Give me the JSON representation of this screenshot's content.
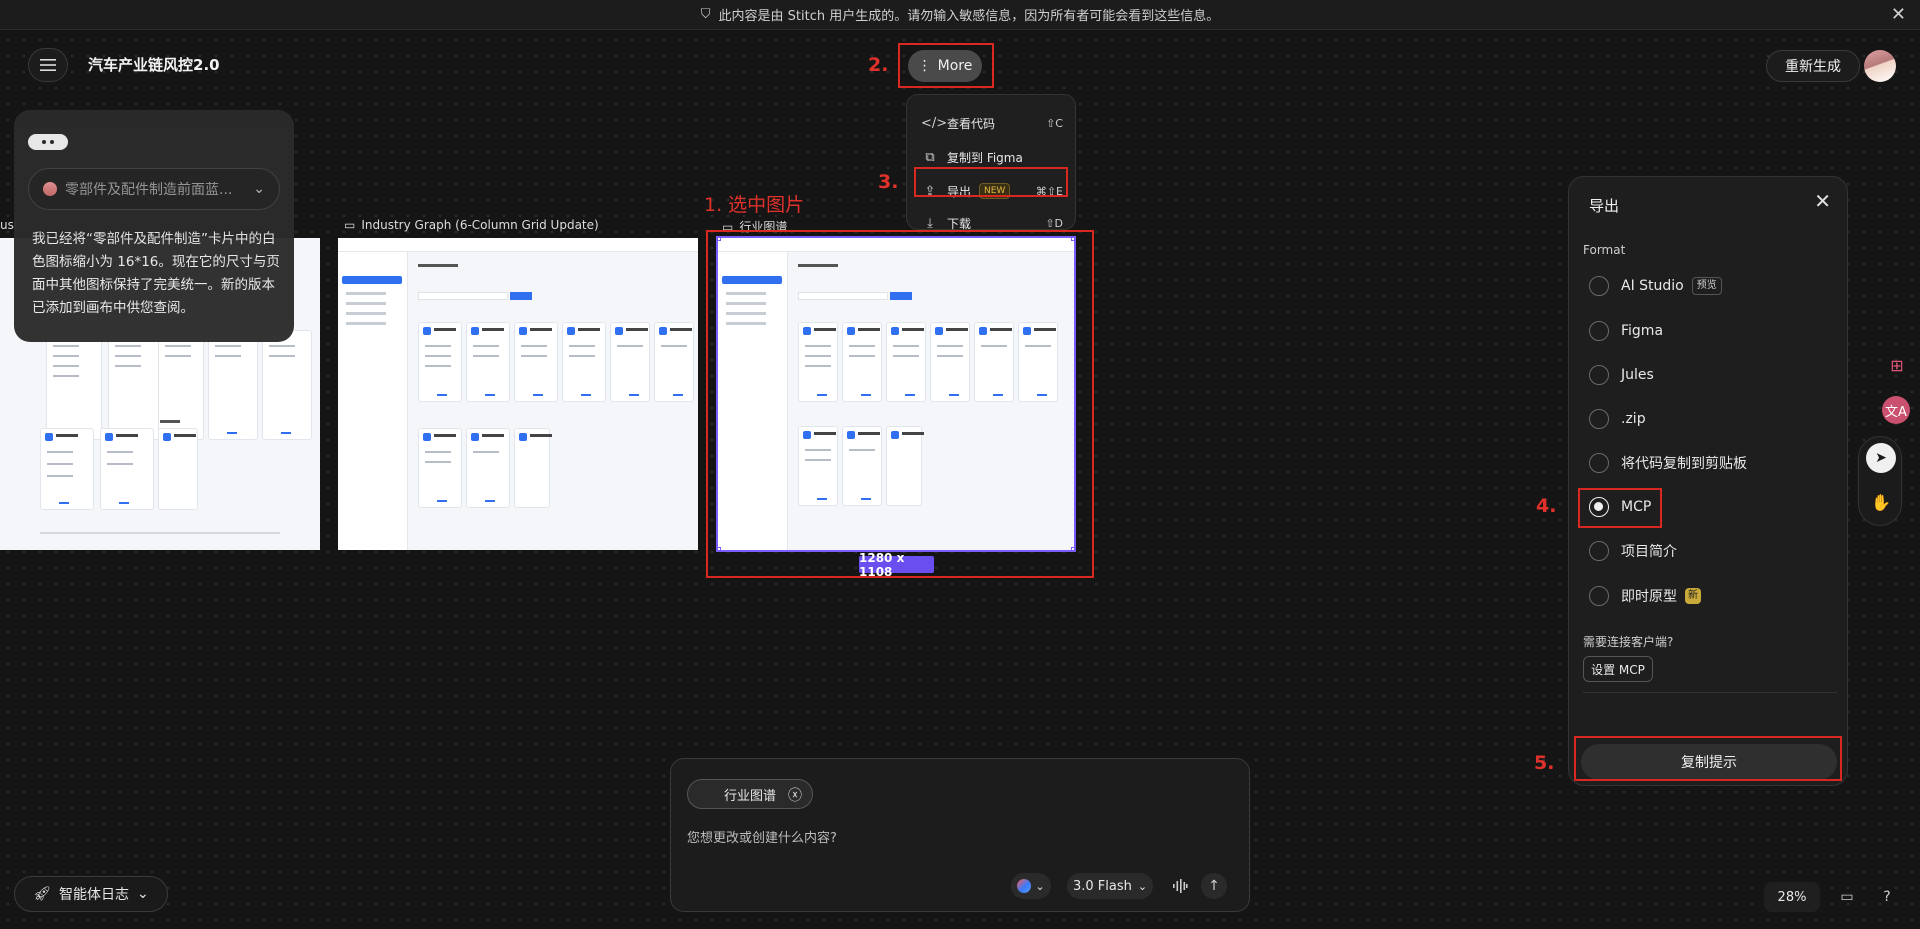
{
  "notice": {
    "text": "此内容是由 Stitch 用户生成的。请勿输入敏感信息，因为所有者可能会看到这些信息。"
  },
  "header": {
    "project_title": "汽车产业链风控2.0",
    "more_label": "More",
    "regenerate_label": "重新生成"
  },
  "annotations": {
    "a1": "1. 选中图片",
    "a2": "2.",
    "a3": "3.",
    "a4": "4.",
    "a5": "5."
  },
  "more_menu": {
    "items": [
      {
        "label": "查看代码",
        "shortcut": "⇧C",
        "icon": "code-icon"
      },
      {
        "label": "复制到 Figma",
        "shortcut": "",
        "icon": "copy-icon"
      },
      {
        "label": "导出",
        "badge": "NEW",
        "shortcut": "⌘⇧E",
        "icon": "export-icon"
      },
      {
        "label": "下载",
        "shortcut": "⇧D",
        "icon": "download-icon"
      }
    ]
  },
  "chat": {
    "selector_text": "零部件及配件制造前面蓝...",
    "message": "我已经将“零部件及配件制造”卡片中的白色图标缩小为 16*16。现在它的尺寸与页面中其他图标保持了完美统一。新的版本已添加到画布中供您查阅。"
  },
  "frames": {
    "frame1_label": "ust",
    "frame2_label": "Industry Graph (6-Column Grid Update)",
    "frame3_label": "行业图谱",
    "selected_size": "1280 x 1108"
  },
  "export_panel": {
    "title": "导出",
    "format_label": "Format",
    "options": [
      {
        "label": "AI Studio",
        "tag": "预览",
        "selected": false
      },
      {
        "label": "Figma",
        "tag": "",
        "selected": false
      },
      {
        "label": "Jules",
        "tag": "",
        "selected": false
      },
      {
        "label": ".zip",
        "tag": "",
        "selected": false
      },
      {
        "label": "将代码复制到剪贴板",
        "tag": "",
        "selected": false
      },
      {
        "label": "MCP",
        "tag": "",
        "selected": true
      },
      {
        "label": "项目简介",
        "tag": "",
        "selected": false
      },
      {
        "label": "即时原型",
        "tag": "新",
        "selected": false
      }
    ],
    "need_client": "需要连接客户端?",
    "setup_mcp": "设置 MCP",
    "copy_prompt": "复制提示"
  },
  "prompt": {
    "chip_label": "行业图谱",
    "placeholder": "您想更改或创建什么内容?",
    "model": "3.0 Flash"
  },
  "footer": {
    "agent_log": "智能体日志",
    "zoom": "28%"
  },
  "colors": {
    "annotation_red": "#d9281f",
    "selection_purple": "#7a5cff",
    "accent_blue": "#2f6ff0"
  }
}
